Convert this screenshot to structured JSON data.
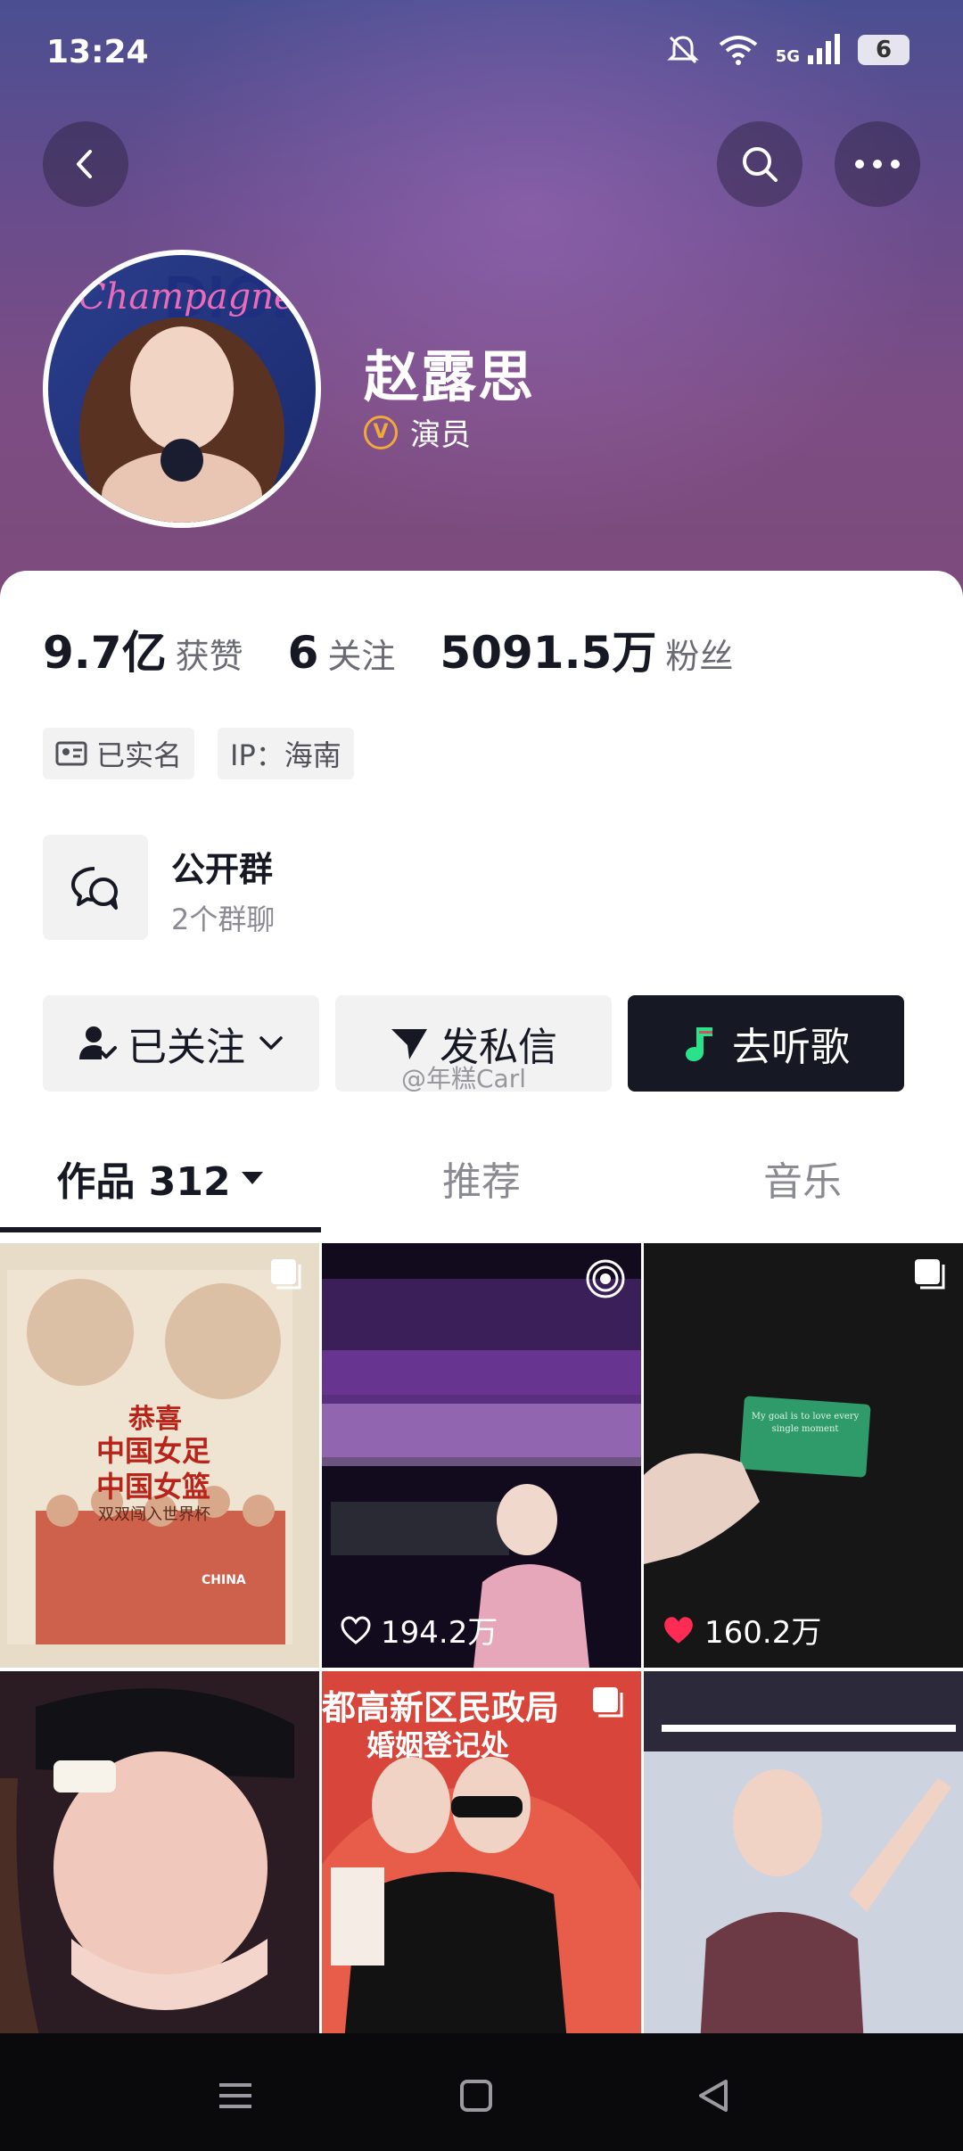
{
  "status_bar": {
    "time": "13:24",
    "network": "5G",
    "battery": "6"
  },
  "profile": {
    "name": "赵露思",
    "role": "演员",
    "verified_badge": "V",
    "avatar_text": "Champagne"
  },
  "stats": [
    {
      "value": "9.7亿",
      "label": "获赞"
    },
    {
      "value": "6",
      "label": "关注"
    },
    {
      "value": "5091.5万",
      "label": "粉丝"
    }
  ],
  "chips": {
    "real_name": "已实名",
    "ip": "IP：海南"
  },
  "group": {
    "title": "公开群",
    "subtitle": "2个群聊"
  },
  "actions": {
    "follow": "已关注",
    "message": "发私信",
    "music": "去听歌"
  },
  "watermark": "@年糕Carl",
  "tabs": [
    {
      "label": "作品 312"
    },
    {
      "label": "推荐"
    },
    {
      "label": "音乐"
    }
  ],
  "grid": {
    "poster_texts": [
      "恭喜",
      "中国女足",
      "中国女篮",
      "双双闯入世界杯"
    ],
    "jersey_text": "CHINA",
    "card_text": "My goal is to love every single moment",
    "building_text": "都高新区民政局",
    "building_text2": "婚姻登记处",
    "likes": [
      "194.2万",
      "160.2万"
    ]
  },
  "colors": {
    "primary_text": "#161823",
    "dark_button": "#161823",
    "like_red": "#fe2c55",
    "badge_orange": "#f2a93b"
  }
}
